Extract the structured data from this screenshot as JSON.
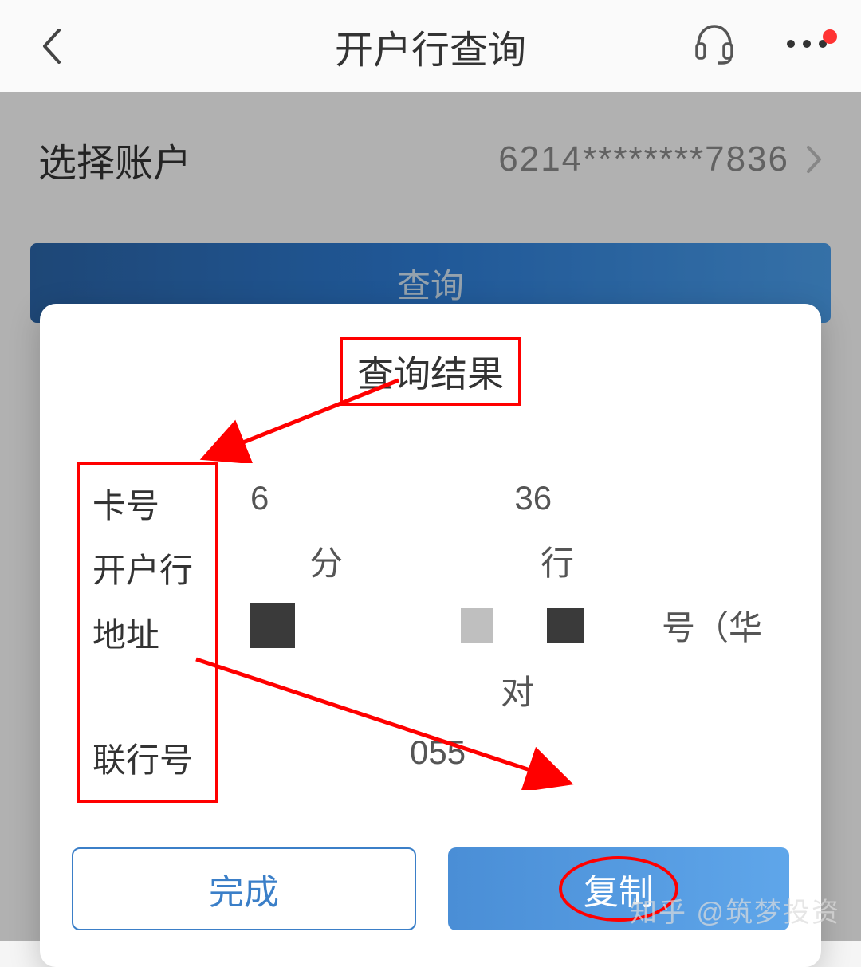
{
  "header": {
    "title": "开户行查询"
  },
  "account": {
    "label": "选择账户",
    "masked_value": "6214********7836"
  },
  "query_button_label": "查询",
  "modal": {
    "title": "查询结果",
    "labels": {
      "card_no": "卡号",
      "branch": "开户行",
      "address": "地址",
      "cnaps": "联行号"
    },
    "values": {
      "card_no_prefix": "6",
      "card_no_suffix": "36",
      "branch_fragment_1": "分",
      "branch_fragment_2": "行",
      "address_fragment_1": "号（华",
      "address_fragment_2": "对",
      "cnaps_fragment": "055"
    },
    "actions": {
      "complete": "完成",
      "copy": "复制"
    }
  },
  "watermark": "知乎 @筑梦投资"
}
